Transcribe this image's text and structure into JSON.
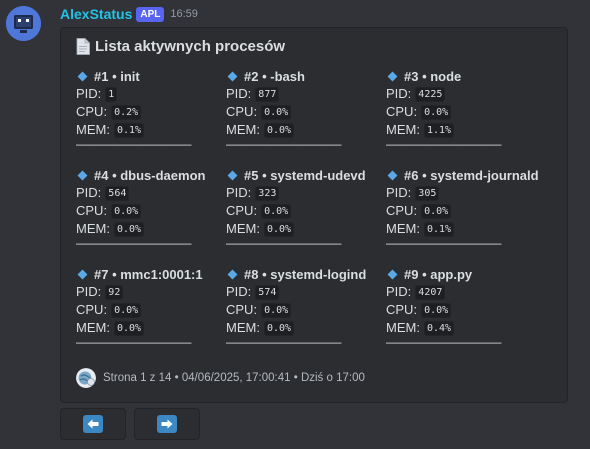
{
  "message": {
    "author": "AlexStatus",
    "app_tag": "APL",
    "timestamp": "16:59"
  },
  "embed": {
    "title": "Lista aktywnych procesów",
    "title_icon": "page-icon",
    "labels": {
      "pid": "PID:",
      "cpu": "CPU:",
      "mem": "MEM:"
    },
    "separator": "——————————",
    "processes": [
      {
        "title": "#1 • init",
        "pid": "1",
        "cpu": "0.2%",
        "mem": "0.1%"
      },
      {
        "title": "#2 • -bash",
        "pid": "877",
        "cpu": "0.0%",
        "mem": "0.0%"
      },
      {
        "title": "#3 • node",
        "pid": "4225",
        "cpu": "0.0%",
        "mem": "1.1%"
      },
      {
        "title": "#4 • dbus-daemon",
        "pid": "564",
        "cpu": "0.0%",
        "mem": "0.0%"
      },
      {
        "title": "#5 • systemd-udevd",
        "pid": "323",
        "cpu": "0.0%",
        "mem": "0.0%"
      },
      {
        "title": "#6 • systemd-journald",
        "pid": "305",
        "cpu": "0.0%",
        "mem": "0.1%"
      },
      {
        "title": "#7 • mmc1:0001:1",
        "pid": "92",
        "cpu": "0.0%",
        "mem": "0.0%"
      },
      {
        "title": "#8 • systemd-logind",
        "pid": "574",
        "cpu": "0.0%",
        "mem": "0.0%"
      },
      {
        "title": "#9 • app.py",
        "pid": "4207",
        "cpu": "0.0%",
        "mem": "0.4%"
      }
    ],
    "footer": {
      "text": "Strona 1 z 14 • 04/06/2025, 17:00:41 • Dziś o 17:00",
      "icon": "globe-avatar-icon"
    }
  },
  "buttons": {
    "prev_icon": "arrow-left-icon",
    "next_icon": "arrow-right-icon"
  },
  "colors": {
    "background": "#313338",
    "embed_background": "#2b2d31",
    "username": "#22c3e6",
    "app_tag": "#5865f2",
    "diamond": "#5aa9e6",
    "arrow_button": "#3b88c3"
  }
}
